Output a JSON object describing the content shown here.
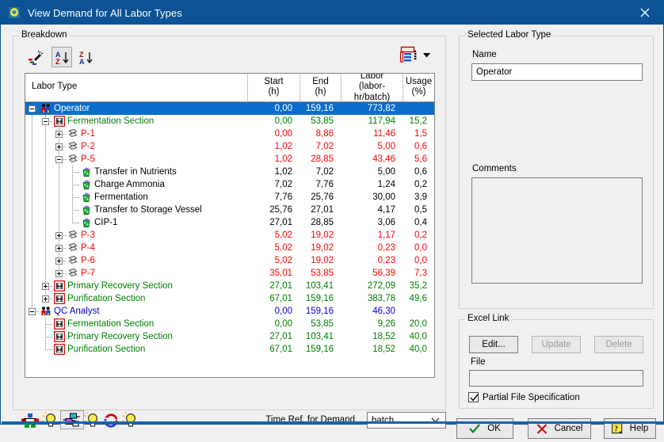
{
  "window": {
    "title": "View Demand for All Labor Types",
    "app_icon": "app-icon",
    "close_label": "✕",
    "accent": "#0b5394"
  },
  "breakdown": {
    "legend": "Breakdown",
    "toolbar": [
      {
        "name": "filter-wand-icon",
        "pressed": false
      },
      {
        "name": "sort-ascending-icon",
        "pressed": true
      },
      {
        "name": "sort-descending-icon",
        "pressed": false
      }
    ],
    "view_menu": {
      "name": "view-options-icon",
      "label": ""
    },
    "columns": [
      {
        "key": "name",
        "line1": "Labor Type",
        "line2": ""
      },
      {
        "key": "start",
        "line1": "Start",
        "line2": "(h)"
      },
      {
        "key": "end",
        "line1": "End",
        "line2": "(h)"
      },
      {
        "key": "labor",
        "line1": "Labor",
        "line2": "(labor-hr/batch)"
      },
      {
        "key": "usage",
        "line1": "Usage",
        "line2": "(%)"
      }
    ],
    "rows": [
      {
        "label": "Operator",
        "depth": 0,
        "icon": "labor-people-icon",
        "toggle": "minus",
        "color": "#0000cc",
        "selected": true,
        "start": "0,00",
        "end": "159,16",
        "labor": "773,82",
        "usage": ""
      },
      {
        "label": "Fermentation Section",
        "depth": 1,
        "icon": "section-icon",
        "toggle": "minus",
        "color": "#008000",
        "selected": false,
        "start": "0,00",
        "end": "53,85",
        "labor": "117,94",
        "usage": "15,2"
      },
      {
        "label": "P-1",
        "depth": 2,
        "icon": "procedure-icon",
        "toggle": "plus",
        "color": "#ff0000",
        "selected": false,
        "start": "0,00",
        "end": "8,86",
        "labor": "11,46",
        "usage": "1,5"
      },
      {
        "label": "P-2",
        "depth": 2,
        "icon": "procedure-icon",
        "toggle": "plus",
        "color": "#ff0000",
        "selected": false,
        "start": "1,02",
        "end": "7,02",
        "labor": "5,00",
        "usage": "0,6"
      },
      {
        "label": "P-5",
        "depth": 2,
        "icon": "procedure-icon",
        "toggle": "minus",
        "color": "#ff0000",
        "selected": false,
        "start": "1,02",
        "end": "28,85",
        "labor": "43,46",
        "usage": "5,6"
      },
      {
        "label": "Transfer in Nutrients",
        "depth": 3,
        "icon": "operation-icon",
        "toggle": "none",
        "color": "#000000",
        "selected": false,
        "start": "1,02",
        "end": "7,02",
        "labor": "5,00",
        "usage": "0,6"
      },
      {
        "label": "Charge Ammonia",
        "depth": 3,
        "icon": "operation-icon",
        "toggle": "none",
        "color": "#000000",
        "selected": false,
        "start": "7,02",
        "end": "7,76",
        "labor": "1,24",
        "usage": "0,2"
      },
      {
        "label": "Fermentation",
        "depth": 3,
        "icon": "operation-icon",
        "toggle": "none",
        "color": "#000000",
        "selected": false,
        "start": "7,76",
        "end": "25,76",
        "labor": "30,00",
        "usage": "3,9"
      },
      {
        "label": "Transfer to Storage Vessel",
        "depth": 3,
        "icon": "operation-icon",
        "toggle": "none",
        "color": "#000000",
        "selected": false,
        "start": "25,76",
        "end": "27,01",
        "labor": "4,17",
        "usage": "0,5"
      },
      {
        "label": "CIP-1",
        "depth": 3,
        "icon": "operation-icon",
        "toggle": "none",
        "color": "#000000",
        "selected": false,
        "start": "27,01",
        "end": "28,85",
        "labor": "3,06",
        "usage": "0,4"
      },
      {
        "label": "P-3",
        "depth": 2,
        "icon": "procedure-icon",
        "toggle": "plus",
        "color": "#ff0000",
        "selected": false,
        "start": "5,02",
        "end": "19,02",
        "labor": "1,17",
        "usage": "0,2"
      },
      {
        "label": "P-4",
        "depth": 2,
        "icon": "procedure-icon",
        "toggle": "plus",
        "color": "#ff0000",
        "selected": false,
        "start": "5,02",
        "end": "19,02",
        "labor": "0,23",
        "usage": "0,0"
      },
      {
        "label": "P-6",
        "depth": 2,
        "icon": "procedure-icon",
        "toggle": "plus",
        "color": "#ff0000",
        "selected": false,
        "start": "5,02",
        "end": "19,02",
        "labor": "0,23",
        "usage": "0,0"
      },
      {
        "label": "P-7",
        "depth": 2,
        "icon": "procedure-icon",
        "toggle": "plus",
        "color": "#ff0000",
        "selected": false,
        "start": "35,01",
        "end": "53,85",
        "labor": "56,39",
        "usage": "7,3"
      },
      {
        "label": "Primary Recovery Section",
        "depth": 1,
        "icon": "section-icon",
        "toggle": "plus",
        "color": "#008000",
        "selected": false,
        "start": "27,01",
        "end": "103,41",
        "labor": "272,09",
        "usage": "35,2"
      },
      {
        "label": "Purification Section",
        "depth": 1,
        "icon": "section-icon",
        "toggle": "plus",
        "color": "#008000",
        "selected": false,
        "start": "67,01",
        "end": "159,16",
        "labor": "383,78",
        "usage": "49,6"
      },
      {
        "label": "QC Analyst",
        "depth": 0,
        "icon": "labor-people-icon",
        "toggle": "minus",
        "color": "#0000cc",
        "selected": false,
        "start": "0,00",
        "end": "159,16",
        "labor": "46,30",
        "usage": ""
      },
      {
        "label": "Fermentation Section",
        "depth": 1,
        "icon": "section-icon",
        "toggle": "none",
        "color": "#008000",
        "selected": false,
        "start": "0,00",
        "end": "53,85",
        "labor": "9,26",
        "usage": "20,0"
      },
      {
        "label": "Primary Recovery Section",
        "depth": 1,
        "icon": "section-icon",
        "toggle": "none",
        "color": "#008000",
        "selected": false,
        "start": "27,01",
        "end": "103,41",
        "labor": "18,52",
        "usage": "40,0"
      },
      {
        "label": "Purification Section",
        "depth": 1,
        "icon": "section-icon",
        "toggle": "none",
        "color": "#008000",
        "selected": false,
        "start": "67,01",
        "end": "159,16",
        "labor": "18,52",
        "usage": "40,0"
      }
    ],
    "bottom_tools": [
      {
        "name": "show-sections-icon",
        "pressed": false
      },
      {
        "name": "section-bulb-icon",
        "pressed": false
      },
      {
        "name": "show-procedures-icon",
        "pressed": true
      },
      {
        "name": "procedure-bulb-icon",
        "pressed": false
      },
      {
        "name": "refresh-icon",
        "pressed": false
      },
      {
        "name": "refresh-bulb-icon",
        "pressed": false
      }
    ],
    "time_ref_label": "Time Ref. for Demand",
    "time_ref_value": "batch",
    "time_ref_options": [
      "batch"
    ]
  },
  "selected_labor_type": {
    "legend": "Selected Labor Type",
    "name_label": "Name",
    "name_value": "Operator",
    "comments_label": "Comments",
    "comments_value": ""
  },
  "excel_link": {
    "legend": "Excel Link",
    "edit_label": "Edit...",
    "update_label": "Update",
    "delete_label": "Delete",
    "file_label": "File",
    "file_value": "",
    "partial_label": "Partial File Specification",
    "partial_checked": true
  },
  "footer": {
    "ok_label": "OK",
    "cancel_label": "Cancel",
    "help_label": "Help"
  }
}
